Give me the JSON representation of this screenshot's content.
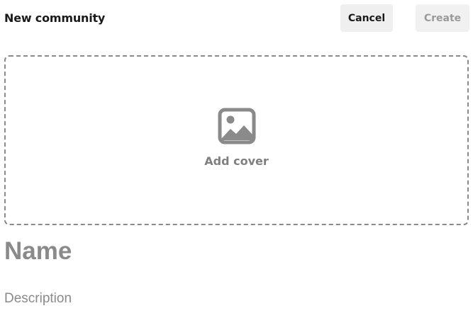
{
  "header": {
    "title": "New community",
    "cancel_label": "Cancel",
    "create_label": "Create"
  },
  "cover": {
    "label": "Add cover",
    "icon": "image-icon"
  },
  "form": {
    "name_placeholder": "Name",
    "description_placeholder": "Description"
  },
  "colors": {
    "button_bg": "#efefef",
    "muted_text": "#8a8a8a",
    "border_dashed": "#8a8a8a",
    "title_text": "#1a1a1a"
  }
}
